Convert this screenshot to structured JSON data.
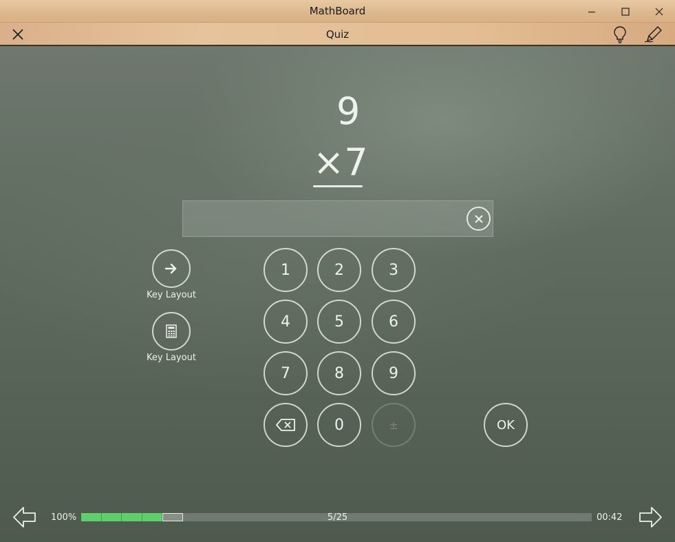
{
  "window": {
    "title": "MathBoard"
  },
  "appbar": {
    "title": "Quiz"
  },
  "problem": {
    "top": "9",
    "bottom": "×7"
  },
  "answer": {
    "value": ""
  },
  "keypad": {
    "k1": "1",
    "k2": "2",
    "k3": "3",
    "k4": "4",
    "k5": "5",
    "k6": "6",
    "k7": "7",
    "k8": "8",
    "k9": "9",
    "k0": "0",
    "sign": "±",
    "ok": "OK"
  },
  "side": {
    "layout_label_1": "Key Layout",
    "layout_label_2": "Key Layout"
  },
  "progress": {
    "percent_label": "100%",
    "count_label": "5/25",
    "timer": "00:42",
    "completed": 4,
    "current": 5,
    "total": 25
  },
  "colors": {
    "progress_done": "#5fcf6e",
    "wood": "#e0bd94"
  }
}
